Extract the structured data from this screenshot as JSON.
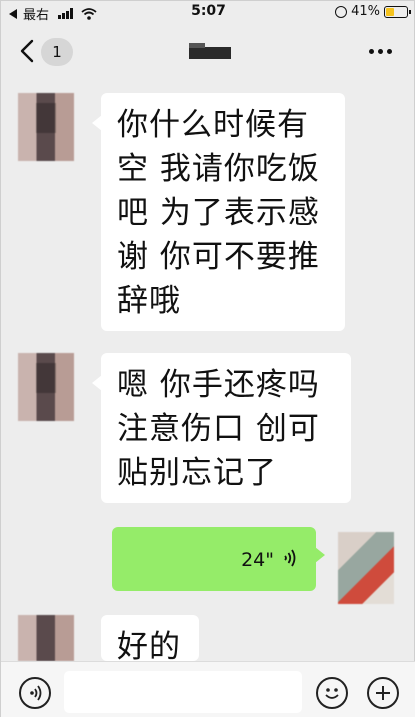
{
  "status_bar": {
    "carrier": "最右",
    "time": "5:07",
    "battery": "41%",
    "battery_level": 0.41
  },
  "nav": {
    "unread_count": "1"
  },
  "messages": [
    {
      "from": "other",
      "text_lines": [
        "你什么时候有",
        "空 我请你吃饭",
        "吧 为了表示感",
        "谢 你可不要推",
        "辞哦"
      ]
    },
    {
      "from": "other",
      "text_lines": [
        "嗯 你手还疼吗",
        "注意伤口 创可",
        "贴别忘记了"
      ]
    },
    {
      "from": "me",
      "type": "voice",
      "duration": "24\""
    },
    {
      "from": "other",
      "text_lines": [
        "好的"
      ]
    }
  ],
  "colors": {
    "background": "#ededed",
    "my_bubble": "#95ec69",
    "other_bubble": "#ffffff",
    "battery_fill": "#f4c21d"
  },
  "icons": [
    "back-arrow-icon",
    "more-dots-icon",
    "voice-wave-icon",
    "voice-input-icon",
    "emoji-icon",
    "plus-icon"
  ]
}
